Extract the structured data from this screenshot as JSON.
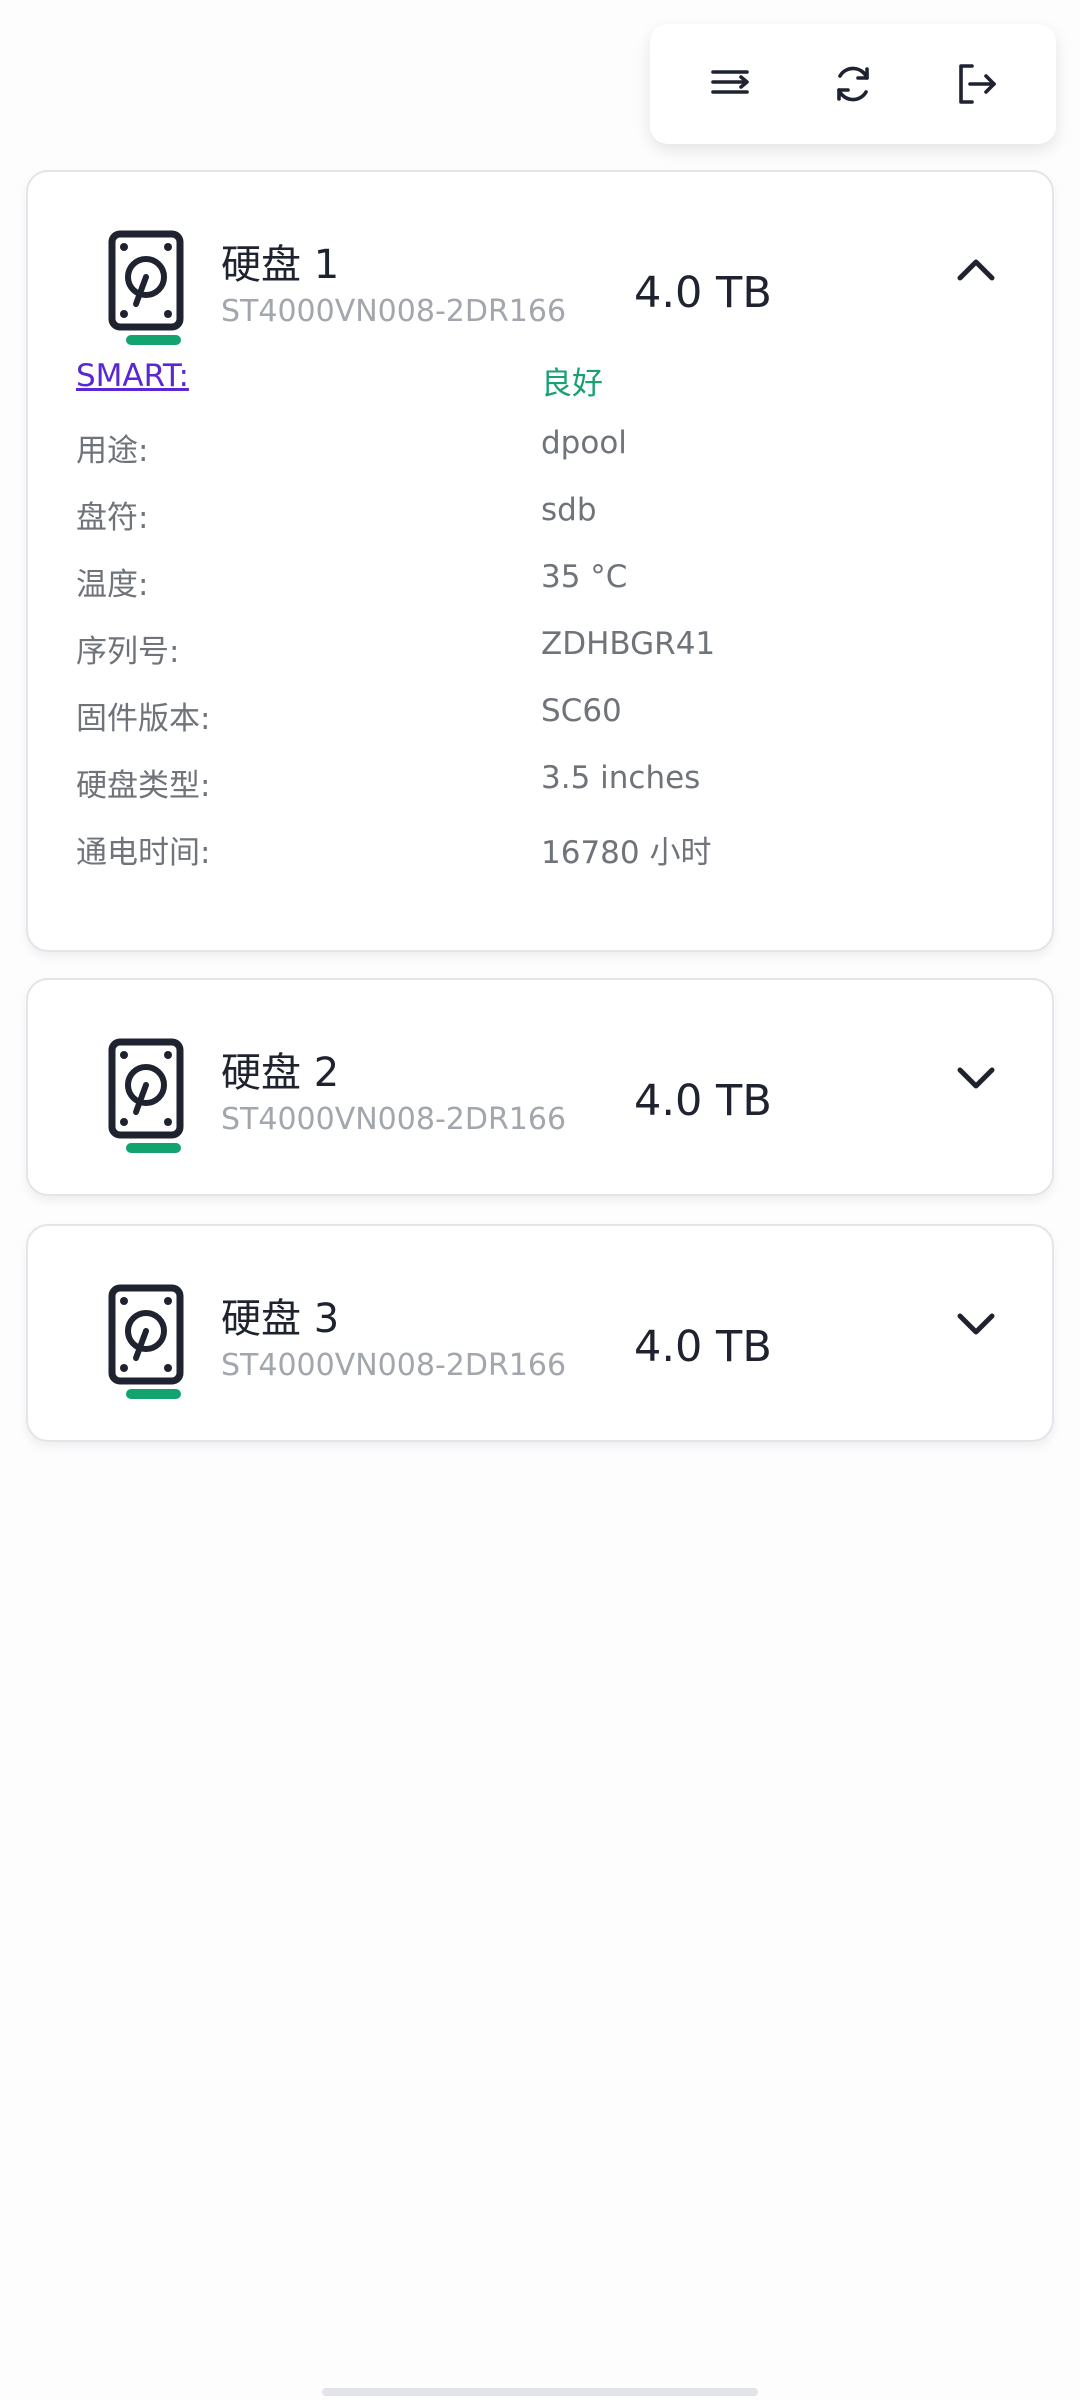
{
  "toolbar": {
    "items": [
      {
        "icon": "sort-lines-icon"
      },
      {
        "icon": "refresh-icon"
      },
      {
        "icon": "logout-icon"
      }
    ]
  },
  "colors": {
    "accent_green": "#12a36f",
    "link_purple": "#5b27d6",
    "good_green": "#1aa071"
  },
  "disks": [
    {
      "name": "硬盘 1",
      "model": "ST4000VN008-2DR166",
      "size": "4.0 TB",
      "expanded": true,
      "details": [
        {
          "label": "SMART:",
          "value": "良好"
        },
        {
          "label": "用途:",
          "value": "dpool"
        },
        {
          "label": "盘符:",
          "value": "sdb"
        },
        {
          "label": "温度:",
          "value": "35 °C"
        },
        {
          "label": "序列号:",
          "value": "ZDHBGR41"
        },
        {
          "label": "固件版本:",
          "value": "SC60"
        },
        {
          "label": "硬盘类型:",
          "value": "3.5 inches"
        },
        {
          "label": "通电时间:",
          "value": "16780 小时"
        }
      ]
    },
    {
      "name": "硬盘 2",
      "model": "ST4000VN008-2DR166",
      "size": "4.0 TB",
      "expanded": false
    },
    {
      "name": "硬盘 3",
      "model": "ST4000VN008-2DR166",
      "size": "4.0 TB",
      "expanded": false
    }
  ]
}
